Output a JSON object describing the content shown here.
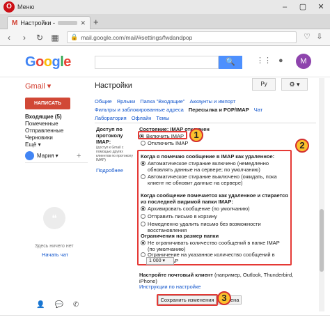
{
  "browser": {
    "menu_label": "Меню",
    "tab_title": "Настройки -",
    "tab_gmail_glyph": "M",
    "url": "mail.google.com/mail/#settings/fwdandpop",
    "opera_glyph": "O"
  },
  "header": {
    "logo": [
      "G",
      "o",
      "o",
      "g",
      "l",
      "e"
    ],
    "avatar_letter": "M",
    "lang_button": "Ру",
    "gear_label": "⚙ ▾"
  },
  "left": {
    "gmail_label": "Gmail ▾",
    "compose_label": "НАПИСАТЬ",
    "folders": [
      "Входящие (5)",
      "Помеченные",
      "Отправленные",
      "Черновики",
      "Ещё ▾"
    ],
    "user_name": "Мария ▾",
    "chat_empty": "Здесь ничего нет",
    "start_chat": "Начать чат"
  },
  "settings": {
    "title": "Настройки",
    "tabs_row1": [
      "Общие",
      "Ярлыки",
      "Папка \"Входящие\"",
      "Аккаунты и импорт"
    ],
    "tabs_row2": [
      "Фильтры и заблокированные адреса",
      "Пересылка и POP/IMAP",
      "Чат"
    ],
    "tabs_row3": [
      "Лаборатория",
      "Офлайн",
      "Темы"
    ],
    "section_label": "Доступ по протоколу IMAP:",
    "section_desc": "(доступ к Gmail с помощью других клиентов по протоколу IMAP)",
    "section_more": "Подробнее",
    "status_heading": "Состояние: IMAP отключен",
    "enable_imap": "Включить IMAP",
    "disable_imap": "Отключить IMAP",
    "delete_heading": "Когда я помечаю сообщение в IMAP как удаленное:",
    "delete_opt1": "Автоматическое стирание включено (немедленно обновлять данные на сервере; по умолчанию)",
    "delete_opt2": "Автоматическое стирание выключено (ожидать, пока клиент не обновит данные на сервере)",
    "expunge_heading": "Когда сообщение помечается как удаленное и стирается из последней видимой папки IMAP:",
    "expunge_opt1": "Архивировать сообщение (по умолчанию)",
    "expunge_opt2": "Отправить письмо в корзину",
    "expunge_opt3": "Немедленно удалить письмо без возможности восстановления",
    "limit_heading": "Ограничения на размер папки",
    "limit_opt1": "Не ограничивать количество сообщений в папке IMAP (по умолчанию)",
    "limit_opt2": "Ограничение на указанное количество сообщений в папках IMAP",
    "limit_value": "1 000 ▾",
    "client_heading": "Настройте почтовый клиент",
    "client_examples": "(например, Outlook, Thunderbird, iPhone)",
    "client_link": "Инструкции по настройке",
    "save_button": "Сохранить изменения",
    "cancel_button": "Отмена"
  },
  "annotations": {
    "badge1": "1",
    "badge2": "2",
    "badge3": "3"
  }
}
